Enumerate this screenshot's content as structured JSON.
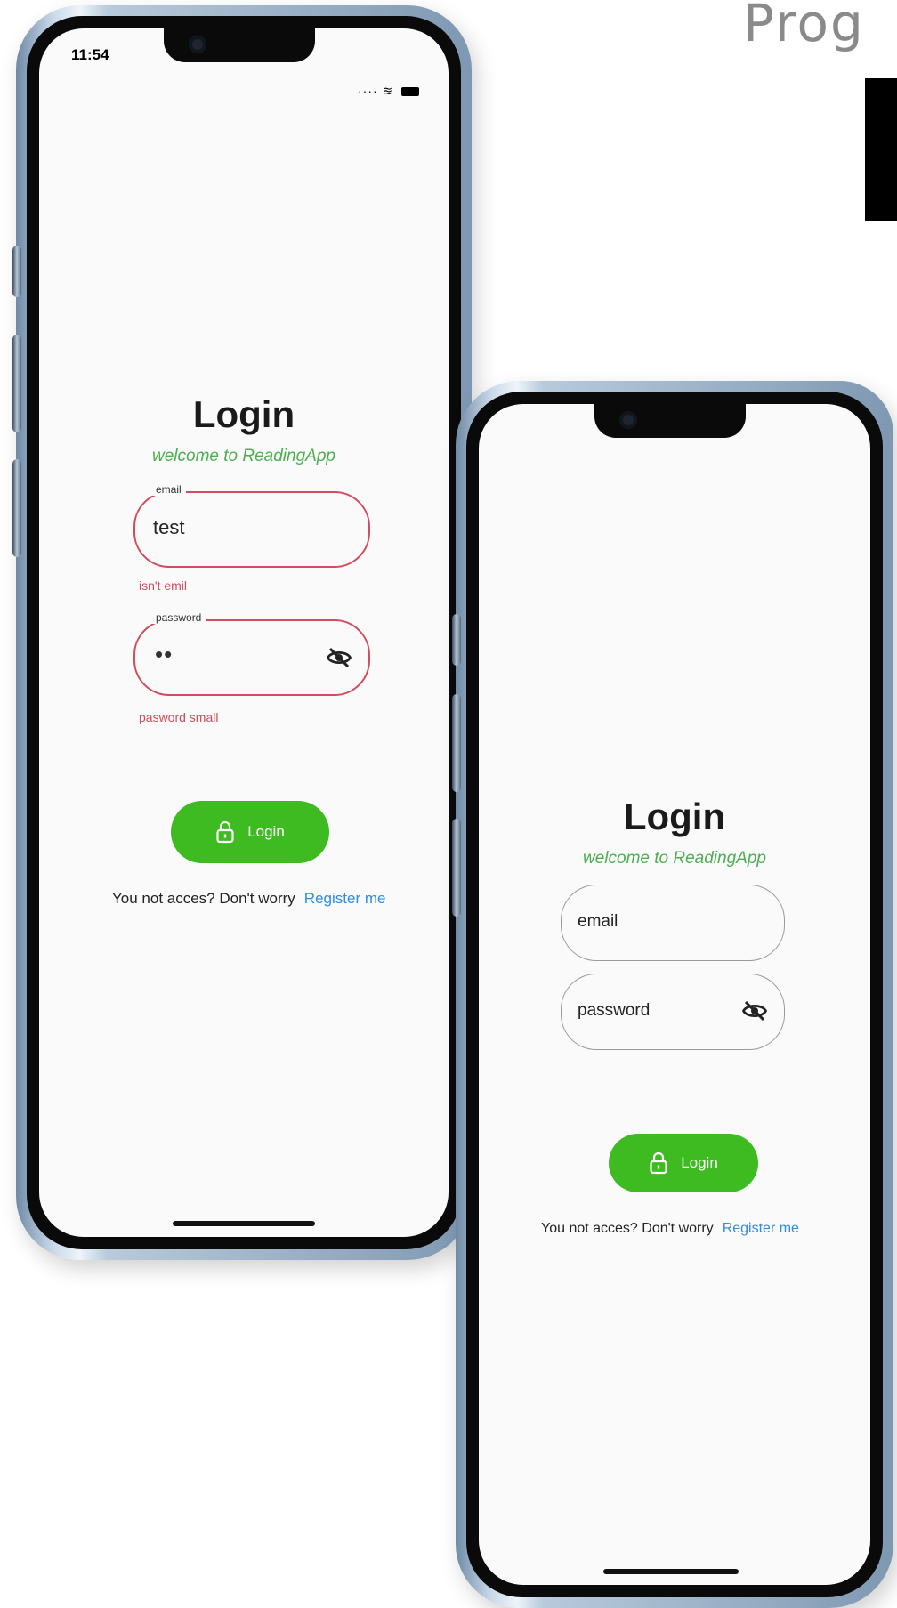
{
  "header": {
    "prog_text": "Prog"
  },
  "phone_left": {
    "status": {
      "time": "11:54",
      "icons": "···· ≋"
    },
    "title": "Login",
    "subtitle": "welcome to ReadingApp",
    "email": {
      "label": "email",
      "value": "test",
      "error": "isn't emil"
    },
    "password": {
      "label": "password",
      "value": "••",
      "error": "pasword small"
    },
    "login_button": "Login",
    "footer_text": "You not acces? Don't worry",
    "register_link": "Register me"
  },
  "phone_right": {
    "title": "Login",
    "subtitle": "welcome to ReadingApp",
    "email": {
      "placeholder": "email"
    },
    "password": {
      "placeholder": "password"
    },
    "login_button": "Login",
    "footer_text": "You not acces? Don't worry",
    "register_link": "Register me"
  },
  "colors": {
    "accent_green": "#3dbb21",
    "subtitle_green": "#4caf50",
    "error_red": "#d24c5c",
    "link_blue": "#2f8de4",
    "screen_bg": "#fafafa"
  },
  "icons": [
    "lock-icon",
    "eye-slash-icon",
    "wifi-icon",
    "battery-icon",
    "signal-icon"
  ]
}
